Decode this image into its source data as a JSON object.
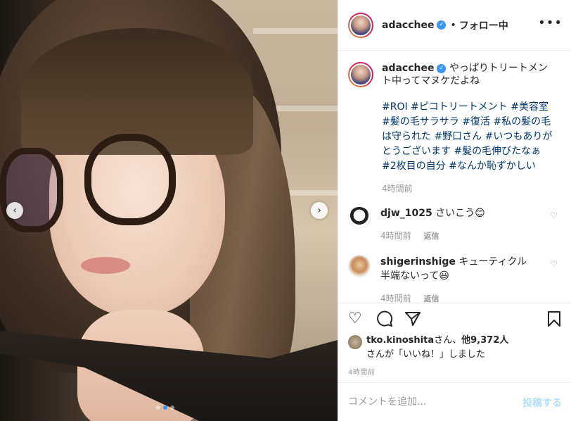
{
  "post": {
    "carousel": {
      "total": 3,
      "active_index": 1
    },
    "icons": {
      "prev": "chevron-left-icon",
      "next": "chevron-right-icon"
    }
  },
  "header": {
    "username": "adacchee",
    "separator": "•",
    "follow_state": "フォロー中",
    "more_icon": "more-options-icon"
  },
  "caption": {
    "username": "adacchee",
    "text": "やっぱりトリートメント中ってマヌケだよね",
    "hashtags": "#ROI #ピコトリートメント #美容室 #髪の毛サラサラ #復活 #私の髪の毛は守られた #野口さん #いつもありがとうございます #髪の毛伸びたなぁ #2枚目の自分 #なんか恥ずかしい",
    "time": "4時間前"
  },
  "comments": [
    {
      "username": "djw_1025",
      "text": "さいこう😊",
      "time": "4時間前",
      "reply": "返信"
    },
    {
      "username": "shigerinshige",
      "text": "キューティクル半端ないって😃",
      "time": "4時間前",
      "reply": "返信"
    }
  ],
  "actions": {
    "like_icon": "heart-icon",
    "comment_icon": "comment-bubble-icon",
    "share_icon": "paper-plane-icon",
    "save_icon": "bookmark-icon"
  },
  "likes": {
    "user": "tko.kinoshita",
    "mid": "さん、",
    "others": "他9,372人",
    "line2": "さんが「いいね！」しました"
  },
  "timestamp": "4時間前",
  "add_comment": {
    "placeholder": "コメントを追加...",
    "post_label": "投稿する"
  },
  "colors": {
    "accent": "#3897f0",
    "link": "#003569",
    "post_disabled": "#b2dffc"
  }
}
